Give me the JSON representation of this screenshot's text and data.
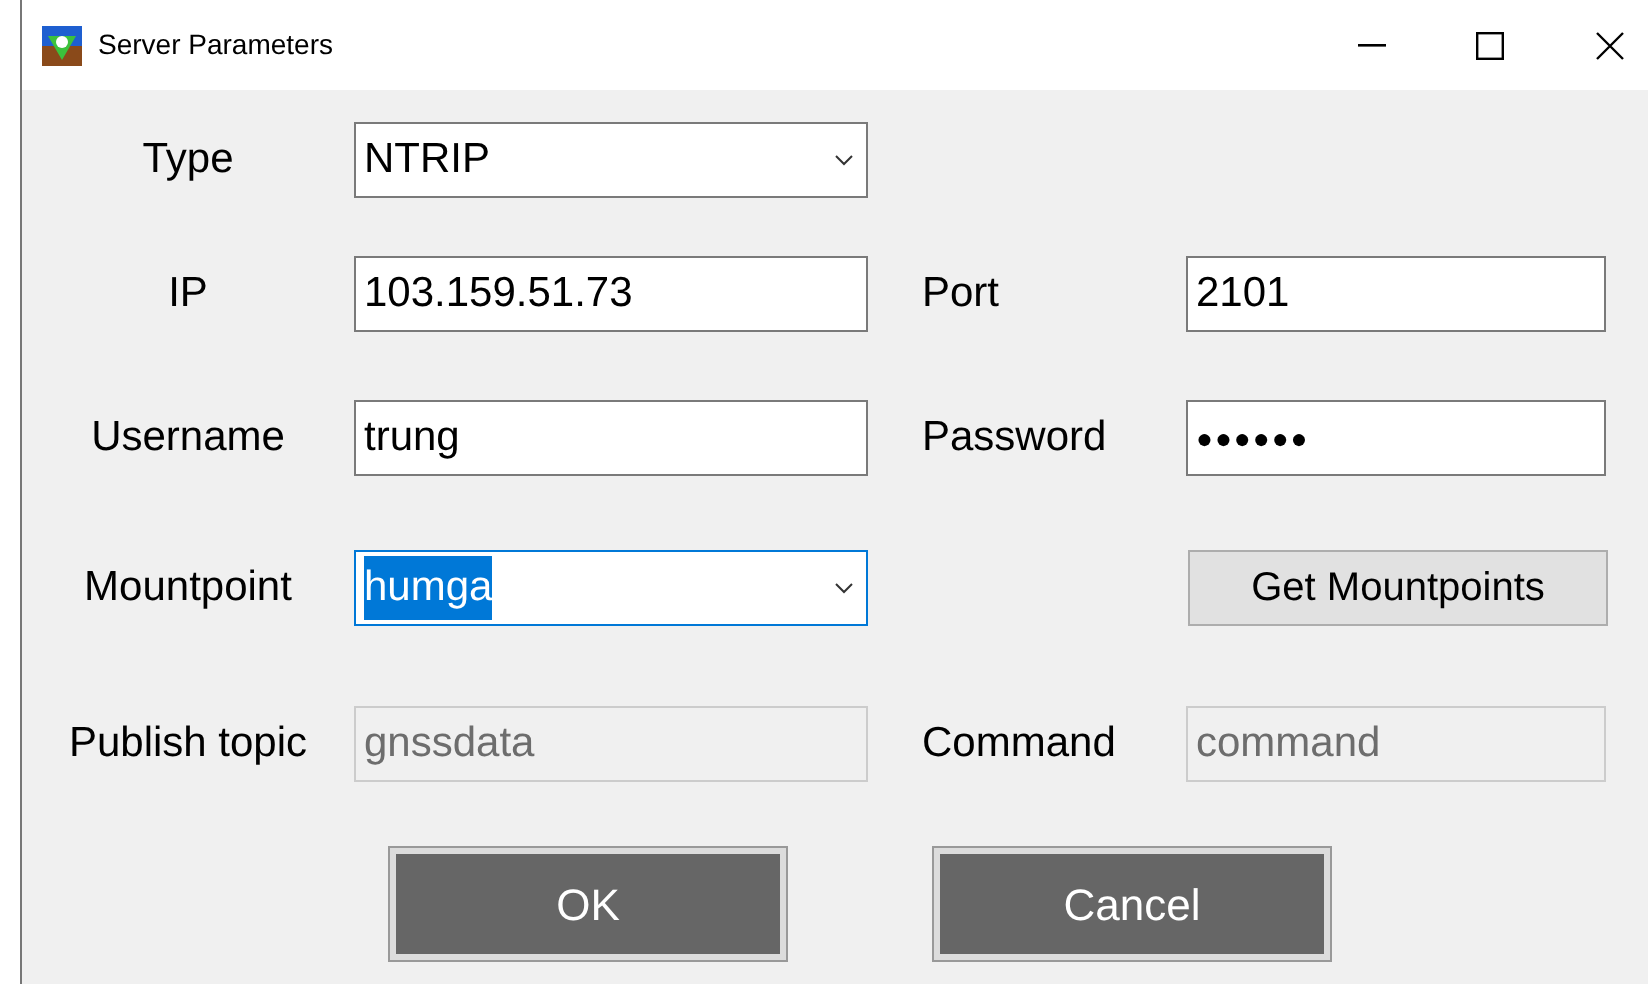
{
  "window": {
    "title": "Server Parameters"
  },
  "rows": [
    {
      "fields": [
        {
          "label": "Type",
          "kind": "dropdown",
          "value": "NTRIP",
          "disabled": false,
          "text_selected": false,
          "focused": false
        }
      ]
    },
    {
      "fields": [
        {
          "label": "IP",
          "kind": "text",
          "value": "103.159.51.73",
          "disabled": false,
          "text_selected": false,
          "focused": false
        },
        {
          "label": "Port",
          "kind": "text",
          "value": "2101",
          "disabled": false,
          "text_selected": false,
          "focused": false
        }
      ]
    },
    {
      "fields": [
        {
          "label": "Username",
          "kind": "text",
          "value": "trung",
          "disabled": false,
          "text_selected": false,
          "focused": false
        },
        {
          "label": "Password",
          "kind": "password",
          "value": "●●●●●●",
          "disabled": false,
          "text_selected": false,
          "focused": false
        }
      ]
    },
    {
      "fields": [
        {
          "label": "Mountpoint",
          "kind": "dropdown",
          "value": "humga",
          "disabled": false,
          "text_selected": true,
          "focused": true
        }
      ],
      "button": "Get Mountpoints"
    },
    {
      "fields": [
        {
          "label": "Publish topic",
          "kind": "text",
          "value": "gnssdata",
          "disabled": true,
          "text_selected": false,
          "focused": false
        },
        {
          "label": "Command",
          "kind": "text",
          "value": "command",
          "disabled": true,
          "text_selected": false,
          "focused": false
        }
      ]
    }
  ],
  "buttons": [
    "OK",
    "Cancel"
  ]
}
